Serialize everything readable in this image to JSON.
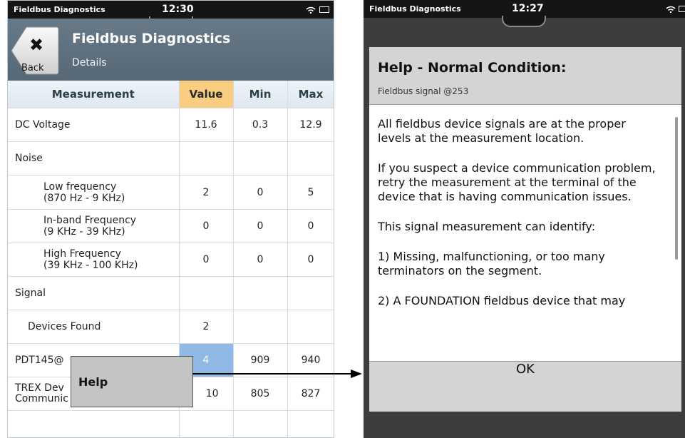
{
  "status_bar": {
    "app_title": "Fieldbus Diagnostics",
    "time_left": "12:30",
    "time_right": "12:27"
  },
  "left_screen": {
    "header": {
      "back_label": "Back",
      "close_glyph": "✖",
      "title": "Fieldbus Diagnostics",
      "subtitle": "Details"
    },
    "table": {
      "columns": [
        "Measurement",
        "Value",
        "Min",
        "Max"
      ],
      "rows": [
        {
          "name": "DC Voltage",
          "value": "11.6",
          "min": "0.3",
          "max": "12.9"
        },
        {
          "name": "Noise",
          "value": "",
          "min": "",
          "max": ""
        },
        {
          "name1": "Low frequency",
          "name2": "(870 Hz - 9 KHz)",
          "value": "2",
          "min": "0",
          "max": "5"
        },
        {
          "name1": "In-band Frequency",
          "name2": "(9 KHz - 39 KHz)",
          "value": "0",
          "min": "0",
          "max": "0"
        },
        {
          "name1": "High Frequency",
          "name2": "(39 KHz - 100 KHz)",
          "value": "0",
          "min": "0",
          "max": "0"
        },
        {
          "name": "Signal",
          "value": "",
          "min": "",
          "max": ""
        },
        {
          "name": "Devices Found",
          "value": "2",
          "min": "",
          "max": ""
        },
        {
          "name": "PDT145@",
          "value": "4",
          "min": "909",
          "max": "940"
        },
        {
          "name1": "TREX Dev",
          "name2": "Communic",
          "value": "10",
          "min": "805",
          "max": "827"
        }
      ]
    },
    "context_menu": {
      "help_label": "Help"
    }
  },
  "right_screen": {
    "dialog": {
      "title": "Help - Normal Condition:",
      "subtitle": "Fieldbus signal @253",
      "paragraphs": [
        "All fieldbus device signals are at the proper levels at the measurement location.",
        "If you suspect a device communication problem, retry the measurement at the terminal of the device that is having communication issues.",
        "This signal measurement can identify:",
        "1) Missing, malfunctioning, or too many terminators on the segment.",
        "2) A FOUNDATION fieldbus device that may"
      ],
      "ok_label": "OK"
    }
  },
  "colors": {
    "value_header": "#f8cd80",
    "selected_cell": "#8fb9e4",
    "header_bar": "#5f7280"
  }
}
